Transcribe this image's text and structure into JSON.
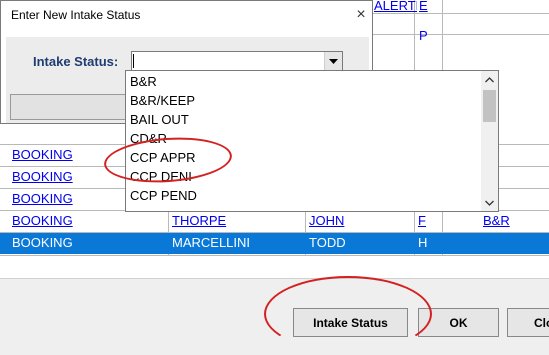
{
  "grid": {
    "headers": {
      "col3_header": "ALERTE",
      "col4_letter": "E"
    },
    "row_p": {
      "col4": "P"
    },
    "rows": [
      {
        "col1": "BOOKING",
        "col2": "",
        "col3": "",
        "col4": "",
        "col5": ""
      },
      {
        "col1": "BOOKING",
        "col2": "",
        "col3": "",
        "col4": "",
        "col5": ""
      },
      {
        "col1": "BOOKING",
        "col2": "",
        "col3": "",
        "col4": "",
        "col5": ""
      },
      {
        "col1": "BOOKING",
        "col2": "THORPE",
        "col3": "JOHN",
        "col4": "F",
        "col5": "B&R"
      }
    ],
    "selected_row": {
      "col1": "BOOKING",
      "col2": "MARCELLINI",
      "col3": "TODD",
      "col4": "H",
      "col5": ""
    }
  },
  "buttons": {
    "intake_status": "Intake Status",
    "ok": "OK",
    "close_partial": "Clo"
  },
  "dialog": {
    "title": "Enter New Intake Status",
    "close_glyph": "×",
    "intake_label": "Intake Status:",
    "combo_value": ""
  },
  "dropdown": {
    "options": [
      "B&R",
      "B&R/KEEP",
      "BAIL OUT",
      "CD&R",
      "CCP APPR",
      "CCP DENI",
      "CCP PEND"
    ]
  },
  "colors": {
    "selection": "#0a78d7",
    "link_text": "#0000ee",
    "annotation": "#d42020"
  }
}
